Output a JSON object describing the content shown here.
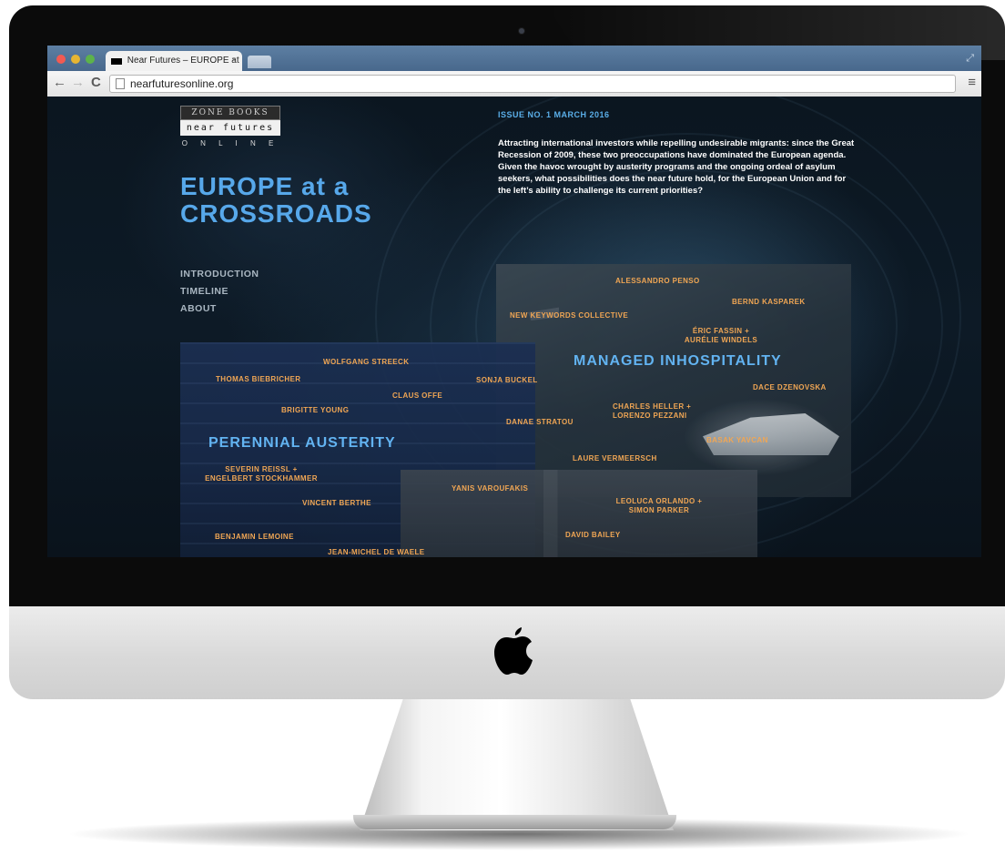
{
  "browser": {
    "tab_title": "Near Futures – EUROPE at",
    "tab_close": "×",
    "url": "nearfuturesonline.org",
    "back_icon": "←",
    "forward_icon": "→",
    "reload_icon": "C",
    "menu_icon": "≡"
  },
  "site": {
    "logo": {
      "publisher": "ZONE BOOKS",
      "name": "near futures",
      "tagline": "O N L I N E"
    },
    "title_line1": "EUROPE at a",
    "title_line2": "CROSSROADS",
    "issue": "ISSUE NO. 1   MARCH 2016",
    "intro": "Attracting international investors while repelling undesirable migrants: since the Great Recession of 2009, these two preoccupations have dominated the European agenda. Given the havoc wrought by austerity programs and the ongoing ordeal of asylum seekers, what possibilities does the near future hold, for the European Union and for the left’s ability to challenge its current priorities?",
    "nav": [
      "INTRODUCTION",
      "TIMELINE",
      "ABOUT"
    ],
    "themes": {
      "managed": "MANAGED INHOSPITALITY",
      "austerity": "PERENNIAL AUSTERITY"
    },
    "authors": {
      "penso": "ALESSANDRO PENSO",
      "kasparek": "BERND KASPAREK",
      "nkc": "NEW KEYWORDS COLLECTIVE",
      "fassin1": "ÉRIC FASSIN +",
      "fassin2": "AURÉLIE WINDELS",
      "dzenovska": "DACE DZENOVSKA",
      "heller1": "CHARLES HELLER +",
      "heller2": "LORENZO PEZZANI",
      "yavcan": "BASAK YAVCAN",
      "vermeersch": "LAURE VERMEERSCH",
      "stratou": "DANAE STRATOU",
      "buckel": "SONJA BUCKEL",
      "streeck": "WOLFGANG STREECK",
      "biebricher": "THOMAS BIEBRICHER",
      "offe": "CLAUS OFFE",
      "young": "BRIGITTE YOUNG",
      "reissl1": "SEVERIN REISSL +",
      "reissl2": "ENGELBERT STOCKHAMMER",
      "varoufakis": "YANIS VAROUFAKIS",
      "berthe": "VINCENT BERTHE",
      "orlando1": "LEOLUCA ORLANDO +",
      "orlando2": "SIMON PARKER",
      "lemoine": "BENJAMIN LEMOINE",
      "bailey": "DAVID BAILEY",
      "dewaele": "JEAN-MICHEL DE WAELE"
    }
  },
  "colors": {
    "accent_blue": "#57a8ea",
    "author_orange": "#f0a654",
    "titlebar": "#48688c"
  },
  "icons": {
    "hardware_logo": "apple-logo-icon",
    "page": "page-icon",
    "camera": "camera-icon"
  }
}
